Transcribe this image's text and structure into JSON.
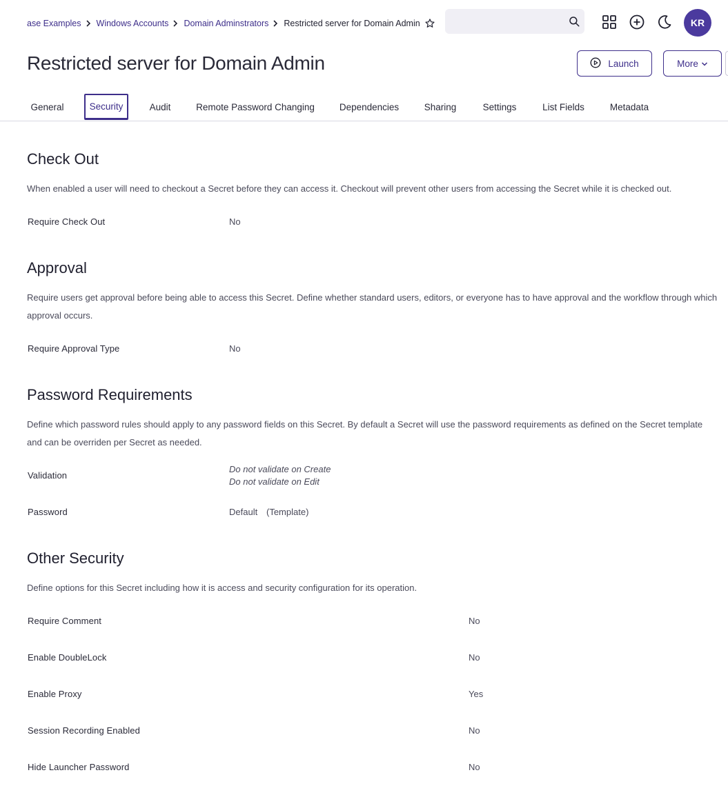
{
  "breadcrumb": {
    "items": [
      "ase Examples",
      "Windows Accounts",
      "Domain Adminstrators"
    ],
    "current": "Restricted server for Domain Admin"
  },
  "search": {
    "placeholder": "",
    "value": ""
  },
  "user": {
    "initials": "KR"
  },
  "page": {
    "title": "Restricted server for Domain Admin"
  },
  "actions": {
    "launch_label": "Launch",
    "more_label": "More"
  },
  "tabs": [
    {
      "label": "General"
    },
    {
      "label": "Security",
      "active": true
    },
    {
      "label": "Audit"
    },
    {
      "label": "Remote Password Changing"
    },
    {
      "label": "Dependencies"
    },
    {
      "label": "Sharing"
    },
    {
      "label": "Settings"
    },
    {
      "label": "List Fields"
    },
    {
      "label": "Metadata"
    }
  ],
  "checkout": {
    "title": "Check Out",
    "description": "When enabled a user will need to checkout a Secret before they can access it. Checkout will prevent other users from accessing the Secret while it is checked out.",
    "require_label": "Require Check Out",
    "require_value": "No"
  },
  "approval": {
    "title": "Approval",
    "description": "Require users get approval before being able to access this Secret. Define whether standard users, editors, or everyone has to have approval and the workflow through which approval occurs.",
    "type_label": "Require Approval Type",
    "type_value": "No"
  },
  "password_requirements": {
    "title": "Password Requirements",
    "description": "Define which password rules should apply to any password fields on this Secret. By default a Secret will use the password requirements as defined on the Secret template and can be overriden per Secret as needed.",
    "validation_label": "Validation",
    "validation_create": "Do not validate on Create",
    "validation_edit": "Do not validate on Edit",
    "password_label": "Password",
    "password_value": "Default",
    "password_note": "(Template)"
  },
  "other_security": {
    "title": "Other Security",
    "description": "Define options for this Secret including how it is access and security configuration for its operation.",
    "fields": [
      {
        "label": "Require Comment",
        "value": "No"
      },
      {
        "label": "Enable DoubleLock",
        "value": "No"
      },
      {
        "label": "Enable Proxy",
        "value": "Yes"
      },
      {
        "label": "Session Recording Enabled",
        "value": "No"
      },
      {
        "label": "Hide Launcher Password",
        "value": "No"
      }
    ]
  },
  "colors": {
    "accent": "#3d2e8a",
    "avatar": "#4b3a9e",
    "search_bg": "#f0eff5"
  }
}
